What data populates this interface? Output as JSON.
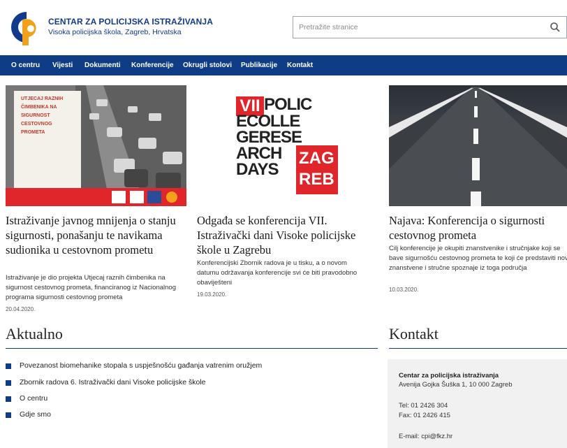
{
  "header": {
    "site_title": "CENTAR ZA POLICIJSKA ISTRAŽIVANJA",
    "site_subtitle": "Visoka policijska škola, Zagreb, Hrvatska",
    "search_placeholder": "Pretražite stranice"
  },
  "nav": {
    "items": [
      "O centru",
      "Vijesti",
      "Dokumenti",
      "Konferencije",
      "Okrugli stolovi",
      "Publikacije",
      "Kontakt"
    ]
  },
  "cards": [
    {
      "poster_lines": [
        "UTJECAJ RAZNIH",
        "ČIMBENIKA NA",
        "SIGURNOST",
        "CESTOVNOG",
        "PROMETA"
      ],
      "title": "Istraživanje javnog mnijenja o stanju sigurnosti, ponašanju te navikama sudionika u cestovnom prometu",
      "text": "Istraživanje je dio projekta Utjecaj raznih čimbenika na sigurnost cestovnog prometa, financiranog iz Nacionalnog programa sigurnosti cestovnog prometa",
      "date": "20.04.2020."
    },
    {
      "logo_lines": [
        "VII",
        "POLIC",
        "ECOLLE",
        "GERESE",
        "ARCH",
        "DAYS",
        "ZAG",
        "REB"
      ],
      "title": "Odgađa se konferencija VII. Istraživački dani Visoke policijske škole u Zagrebu",
      "text": "Konferencijski Zbornik radova je u tisku, a o novom datumu održavanja konferencije svi će biti pravodobno obaviješteni",
      "date": "19.03.2020."
    },
    {
      "title": "Najava: Konferencija o sigurnosti cestovnog prometa",
      "text": "Cilj konferencije je okupiti znanstvenike i stručnjake koji se bave sigurnošću cestovnog prometa te koji će predstaviti nove znanstvene i stručne spoznaje iz toga područja",
      "date": "10.03.2020."
    }
  ],
  "aktualno": {
    "title": "Aktualno",
    "items": [
      "Povezanost biomehanike stopala s uspješnošću gađanja vatrenim oružjem",
      "Zbornik radova 6. Istraživački dani Visoke policijske škole",
      "O centru",
      "Gdje smo"
    ]
  },
  "kontakt": {
    "title": "Kontakt",
    "name": "Centar za policijska istraživanja",
    "address": "Avenija Gojka Šuška 1, 10 000 Zagreb",
    "tel": "Tel: 01 2426 304",
    "fax": "Fax: 01 2426 415",
    "email": "E-mail: cpi@fkz.hr"
  },
  "colors": {
    "brand_blue": "#0e3d85",
    "accent_red": "#e0262b",
    "logo_orange": "#f3a01a"
  }
}
